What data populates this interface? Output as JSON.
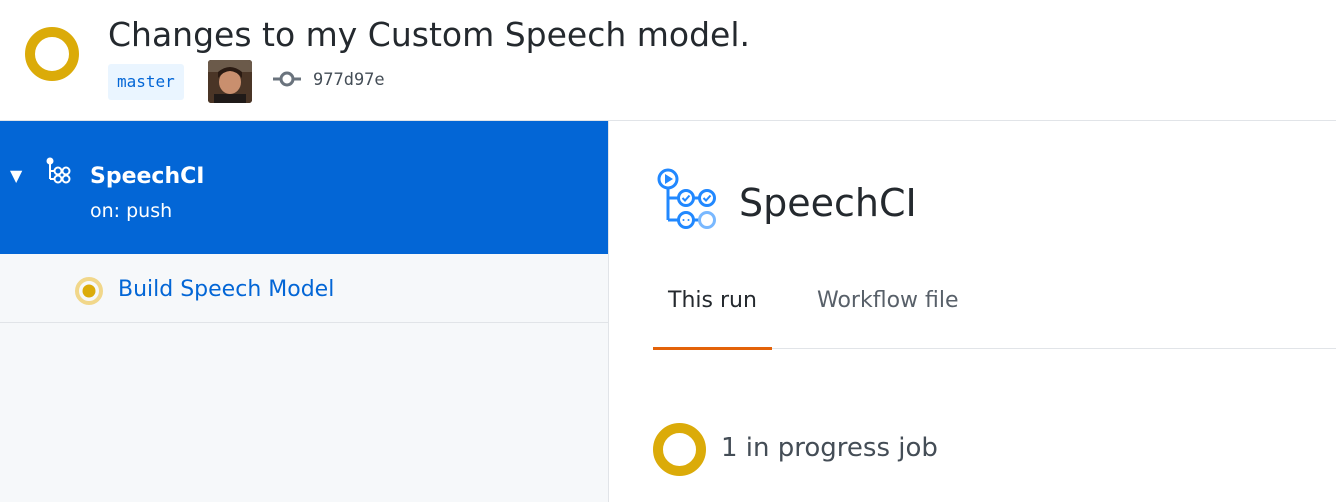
{
  "header": {
    "commit_title": "Changes to my Custom Speech model.",
    "branch": "master",
    "sha": "977d97e",
    "status": "in-progress"
  },
  "sidebar": {
    "workflow": {
      "name": "SpeechCI",
      "event": "on: push",
      "expanded": true
    },
    "jobs": [
      {
        "name": "Build Speech Model",
        "status": "in-progress"
      }
    ]
  },
  "main": {
    "workflow_name": "SpeechCI",
    "tabs": [
      {
        "label": "This run",
        "active": true
      },
      {
        "label": "Workflow file",
        "active": false
      }
    ],
    "progress_summary": "1 in progress job"
  },
  "icons": {
    "status": "in-progress-ring-icon",
    "commit": "git-commit-icon",
    "workflow": "workflow-icon",
    "caret": "triangle-down-icon"
  },
  "colors": {
    "accent_blue": "#0366d6",
    "in_progress_yellow": "#dbab09",
    "tab_underline": "#e36209",
    "sidebar_bg": "#f6f8fa"
  }
}
